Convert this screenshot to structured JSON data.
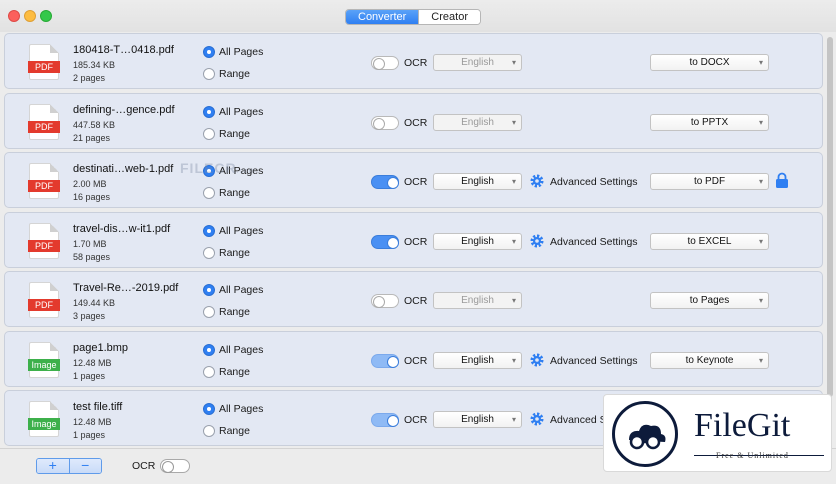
{
  "titlebar": {
    "tabs": [
      {
        "label": "Converter",
        "active": true
      },
      {
        "label": "Creator",
        "active": false
      }
    ]
  },
  "colors": {
    "accent": "#2f7ff2",
    "pdf_tag": "#e33a2d",
    "image_tag": "#3db04b",
    "row_bg": "#e3e8f3"
  },
  "files": [
    {
      "icon": "pdf-file-icon",
      "tag": "PDF",
      "name": "180418-T…0418.pdf",
      "size": "185.34 KB",
      "pages": "2 pages",
      "page_mode": "all",
      "all_pages_label": "All Pages",
      "range_label": "Range",
      "ocr_on": false,
      "ocr_label": "OCR",
      "language": "English",
      "language_enabled": false,
      "advanced_label": "",
      "target": "to DOCX",
      "locked": false
    },
    {
      "icon": "pdf-file-icon",
      "tag": "PDF",
      "name": "defining-…gence.pdf",
      "size": "447.58 KB",
      "pages": "21 pages",
      "page_mode": "all",
      "all_pages_label": "All Pages",
      "range_label": "Range",
      "ocr_on": false,
      "ocr_label": "OCR",
      "language": "English",
      "language_enabled": false,
      "advanced_label": "",
      "target": "to PPTX",
      "locked": false
    },
    {
      "icon": "pdf-file-icon",
      "tag": "PDF",
      "name": "destinati…web-1.pdf",
      "size": "2.00 MB",
      "pages": "16 pages",
      "page_mode": "all",
      "all_pages_label": "All Pages",
      "range_label": "Range",
      "ocr_on": true,
      "ocr_label": "OCR",
      "language": "English",
      "language_enabled": true,
      "advanced_label": "Advanced Settings",
      "target": "to PDF",
      "locked": true
    },
    {
      "icon": "pdf-file-icon",
      "tag": "PDF",
      "name": "travel-dis…w-it1.pdf",
      "size": "1.70 MB",
      "pages": "58 pages",
      "page_mode": "all",
      "all_pages_label": "All Pages",
      "range_label": "Range",
      "ocr_on": true,
      "ocr_label": "OCR",
      "language": "English",
      "language_enabled": true,
      "advanced_label": "Advanced Settings",
      "target": "to EXCEL",
      "locked": false
    },
    {
      "icon": "pdf-file-icon",
      "tag": "PDF",
      "name": "Travel-Re…-2019.pdf",
      "size": "149.44 KB",
      "pages": "3 pages",
      "page_mode": "all",
      "all_pages_label": "All Pages",
      "range_label": "Range",
      "ocr_on": false,
      "ocr_label": "OCR",
      "language": "English",
      "language_enabled": false,
      "advanced_label": "",
      "target": "to Pages",
      "locked": false
    },
    {
      "icon": "image-file-icon",
      "tag": "Image",
      "name": "page1.bmp",
      "size": "12.48 MB",
      "pages": "1 pages",
      "page_mode": "all",
      "all_pages_label": "All Pages",
      "range_label": "Range",
      "ocr_on": true,
      "ocr_label": "OCR",
      "language": "English",
      "language_enabled": true,
      "advanced_label": "Advanced Settings",
      "target": "to Keynote",
      "locked": false
    },
    {
      "icon": "image-file-icon",
      "tag": "Image",
      "name": "test file.tiff",
      "size": "12.48 MB",
      "pages": "1 pages",
      "page_mode": "all",
      "all_pages_label": "All Pages",
      "range_label": "Range",
      "ocr_on": true,
      "ocr_label": "OCR",
      "language": "English",
      "language_enabled": true,
      "advanced_label": "Advanced S",
      "target": "",
      "locked": false
    }
  ],
  "bottombar": {
    "add_label": "+",
    "remove_label": "−",
    "ocr_label": "OCR"
  },
  "watermarks": {
    "filecr": "FILECR",
    "filecr_sub": ".com",
    "filegit_name": "FileGit",
    "filegit_tagline": "Free & Unlimited"
  }
}
